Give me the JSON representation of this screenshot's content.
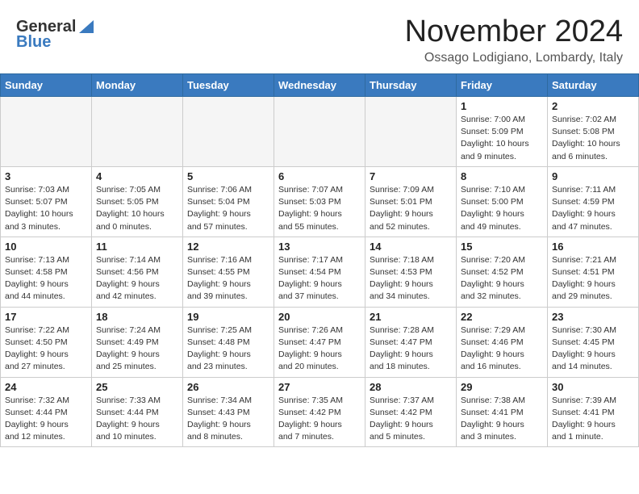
{
  "header": {
    "logo_general": "General",
    "logo_blue": "Blue",
    "month_title": "November 2024",
    "location": "Ossago Lodigiano, Lombardy, Italy"
  },
  "days_of_week": [
    "Sunday",
    "Monday",
    "Tuesday",
    "Wednesday",
    "Thursday",
    "Friday",
    "Saturday"
  ],
  "weeks": [
    [
      {
        "day": "",
        "info": "",
        "empty": true
      },
      {
        "day": "",
        "info": "",
        "empty": true
      },
      {
        "day": "",
        "info": "",
        "empty": true
      },
      {
        "day": "",
        "info": "",
        "empty": true
      },
      {
        "day": "",
        "info": "",
        "empty": true
      },
      {
        "day": "1",
        "info": "Sunrise: 7:00 AM\nSunset: 5:09 PM\nDaylight: 10 hours\nand 9 minutes.",
        "empty": false
      },
      {
        "day": "2",
        "info": "Sunrise: 7:02 AM\nSunset: 5:08 PM\nDaylight: 10 hours\nand 6 minutes.",
        "empty": false
      }
    ],
    [
      {
        "day": "3",
        "info": "Sunrise: 7:03 AM\nSunset: 5:07 PM\nDaylight: 10 hours\nand 3 minutes.",
        "empty": false
      },
      {
        "day": "4",
        "info": "Sunrise: 7:05 AM\nSunset: 5:05 PM\nDaylight: 10 hours\nand 0 minutes.",
        "empty": false
      },
      {
        "day": "5",
        "info": "Sunrise: 7:06 AM\nSunset: 5:04 PM\nDaylight: 9 hours\nand 57 minutes.",
        "empty": false
      },
      {
        "day": "6",
        "info": "Sunrise: 7:07 AM\nSunset: 5:03 PM\nDaylight: 9 hours\nand 55 minutes.",
        "empty": false
      },
      {
        "day": "7",
        "info": "Sunrise: 7:09 AM\nSunset: 5:01 PM\nDaylight: 9 hours\nand 52 minutes.",
        "empty": false
      },
      {
        "day": "8",
        "info": "Sunrise: 7:10 AM\nSunset: 5:00 PM\nDaylight: 9 hours\nand 49 minutes.",
        "empty": false
      },
      {
        "day": "9",
        "info": "Sunrise: 7:11 AM\nSunset: 4:59 PM\nDaylight: 9 hours\nand 47 minutes.",
        "empty": false
      }
    ],
    [
      {
        "day": "10",
        "info": "Sunrise: 7:13 AM\nSunset: 4:58 PM\nDaylight: 9 hours\nand 44 minutes.",
        "empty": false
      },
      {
        "day": "11",
        "info": "Sunrise: 7:14 AM\nSunset: 4:56 PM\nDaylight: 9 hours\nand 42 minutes.",
        "empty": false
      },
      {
        "day": "12",
        "info": "Sunrise: 7:16 AM\nSunset: 4:55 PM\nDaylight: 9 hours\nand 39 minutes.",
        "empty": false
      },
      {
        "day": "13",
        "info": "Sunrise: 7:17 AM\nSunset: 4:54 PM\nDaylight: 9 hours\nand 37 minutes.",
        "empty": false
      },
      {
        "day": "14",
        "info": "Sunrise: 7:18 AM\nSunset: 4:53 PM\nDaylight: 9 hours\nand 34 minutes.",
        "empty": false
      },
      {
        "day": "15",
        "info": "Sunrise: 7:20 AM\nSunset: 4:52 PM\nDaylight: 9 hours\nand 32 minutes.",
        "empty": false
      },
      {
        "day": "16",
        "info": "Sunrise: 7:21 AM\nSunset: 4:51 PM\nDaylight: 9 hours\nand 29 minutes.",
        "empty": false
      }
    ],
    [
      {
        "day": "17",
        "info": "Sunrise: 7:22 AM\nSunset: 4:50 PM\nDaylight: 9 hours\nand 27 minutes.",
        "empty": false
      },
      {
        "day": "18",
        "info": "Sunrise: 7:24 AM\nSunset: 4:49 PM\nDaylight: 9 hours\nand 25 minutes.",
        "empty": false
      },
      {
        "day": "19",
        "info": "Sunrise: 7:25 AM\nSunset: 4:48 PM\nDaylight: 9 hours\nand 23 minutes.",
        "empty": false
      },
      {
        "day": "20",
        "info": "Sunrise: 7:26 AM\nSunset: 4:47 PM\nDaylight: 9 hours\nand 20 minutes.",
        "empty": false
      },
      {
        "day": "21",
        "info": "Sunrise: 7:28 AM\nSunset: 4:47 PM\nDaylight: 9 hours\nand 18 minutes.",
        "empty": false
      },
      {
        "day": "22",
        "info": "Sunrise: 7:29 AM\nSunset: 4:46 PM\nDaylight: 9 hours\nand 16 minutes.",
        "empty": false
      },
      {
        "day": "23",
        "info": "Sunrise: 7:30 AM\nSunset: 4:45 PM\nDaylight: 9 hours\nand 14 minutes.",
        "empty": false
      }
    ],
    [
      {
        "day": "24",
        "info": "Sunrise: 7:32 AM\nSunset: 4:44 PM\nDaylight: 9 hours\nand 12 minutes.",
        "empty": false
      },
      {
        "day": "25",
        "info": "Sunrise: 7:33 AM\nSunset: 4:44 PM\nDaylight: 9 hours\nand 10 minutes.",
        "empty": false
      },
      {
        "day": "26",
        "info": "Sunrise: 7:34 AM\nSunset: 4:43 PM\nDaylight: 9 hours\nand 8 minutes.",
        "empty": false
      },
      {
        "day": "27",
        "info": "Sunrise: 7:35 AM\nSunset: 4:42 PM\nDaylight: 9 hours\nand 7 minutes.",
        "empty": false
      },
      {
        "day": "28",
        "info": "Sunrise: 7:37 AM\nSunset: 4:42 PM\nDaylight: 9 hours\nand 5 minutes.",
        "empty": false
      },
      {
        "day": "29",
        "info": "Sunrise: 7:38 AM\nSunset: 4:41 PM\nDaylight: 9 hours\nand 3 minutes.",
        "empty": false
      },
      {
        "day": "30",
        "info": "Sunrise: 7:39 AM\nSunset: 4:41 PM\nDaylight: 9 hours\nand 1 minute.",
        "empty": false
      }
    ]
  ],
  "colors": {
    "header_bg": "#3a7abf",
    "empty_bg": "#f5f5f5"
  }
}
